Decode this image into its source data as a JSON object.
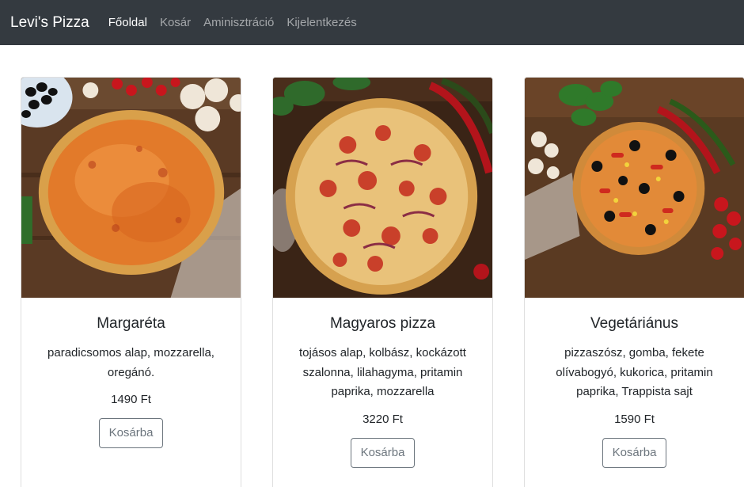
{
  "navbar": {
    "brand": "Levi's Pizza",
    "links": [
      {
        "label": "Főoldal",
        "active": true
      },
      {
        "label": "Kosár",
        "active": false
      },
      {
        "label": "Aminisztráció",
        "active": false
      },
      {
        "label": "Kijelentkezés",
        "active": false
      }
    ]
  },
  "products": [
    {
      "image": "pizza-margareta-photo",
      "name": "Margaréta",
      "description": "paradicsomos alap, mozzarella, oregánó.",
      "price": "1490 Ft",
      "button": "Kosárba"
    },
    {
      "image": "pizza-magyaros-photo",
      "name": "Magyaros pizza",
      "description": "tojásos alap, kolbász, kockázott szalonna, lilahagyma, pritamin paprika, mozzarella",
      "price": "3220 Ft",
      "button": "Kosárba"
    },
    {
      "image": "pizza-vegetarianus-photo",
      "name": "Vegetáriánus",
      "description": "pizzaszósz, gomba, fekete olívabogyó, kukorica, pritamin paprika, Trappista sajt",
      "price": "1590 Ft",
      "button": "Kosárba"
    }
  ],
  "colors": {
    "navbar_bg": "#343a40",
    "button_border": "#6c757d"
  }
}
